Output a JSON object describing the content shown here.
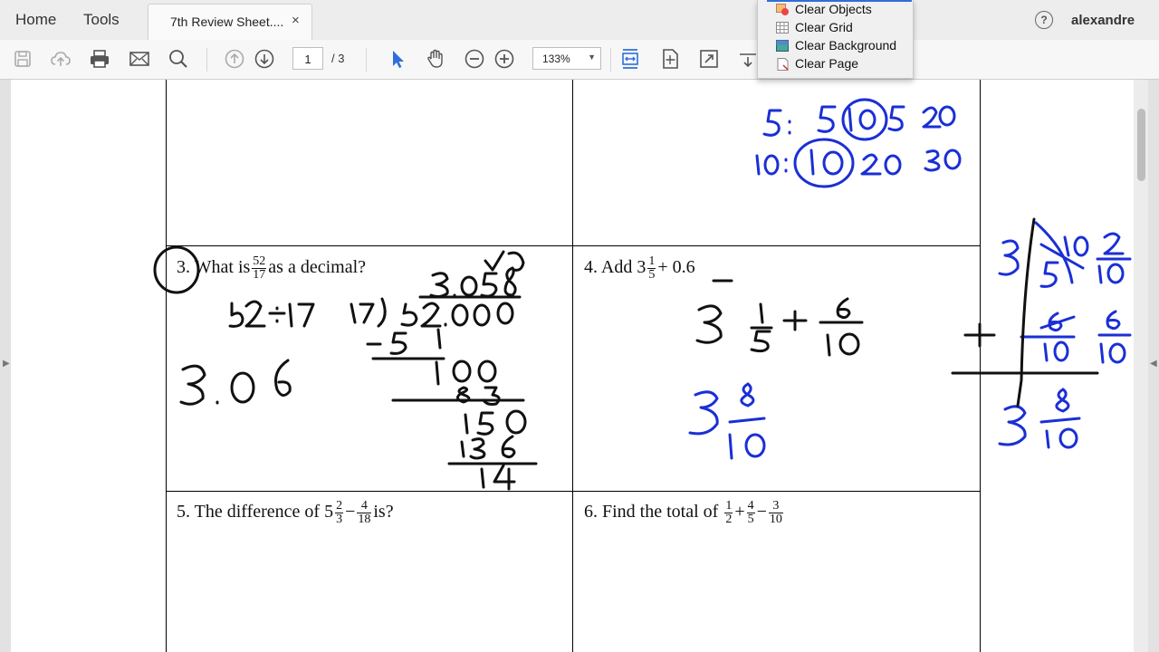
{
  "nav": {
    "home": "Home",
    "tools": "Tools",
    "doc_tab": "7th Review Sheet....",
    "close_glyph": "×",
    "help_glyph": "?",
    "user": "alexandre"
  },
  "toolbar": {
    "page_current": "1",
    "page_total": "/ 3",
    "zoom": "133%",
    "icons": [
      "save-icon",
      "upload-icon",
      "print-icon",
      "email-icon",
      "search-icon",
      "page-up-icon",
      "page-down-icon",
      "select-arrow-icon",
      "hand-icon",
      "zoom-out-icon",
      "zoom-in-icon",
      "fit-width-icon",
      "fit-page-icon",
      "full-screen-icon",
      "tools-dropdown-icon"
    ]
  },
  "menu": {
    "items": [
      "Clear Objects",
      "Clear Grid",
      "Clear Background",
      "Clear Page"
    ]
  },
  "document": {
    "q3": {
      "prefix": "3. What is",
      "num": "52",
      "den": "17",
      "suffix": "as a decimal?"
    },
    "q4": {
      "prefix": "4. Add 3",
      "num": "1",
      "den": "5",
      "suffix": "+ 0.6"
    },
    "q5": {
      "prefix": "5.  The difference of 5",
      "n1": "2",
      "d1": "3",
      "minus": "−",
      "n2": "4",
      "d2": "18",
      "suffix": "is?"
    },
    "q6": {
      "prefix": "6.   Find the total of",
      "n1": "1",
      "d1": "2",
      "plus": "+",
      "n2": "4",
      "d2": "5",
      "minus": "−",
      "n3": "3",
      "d3": "10"
    }
  }
}
